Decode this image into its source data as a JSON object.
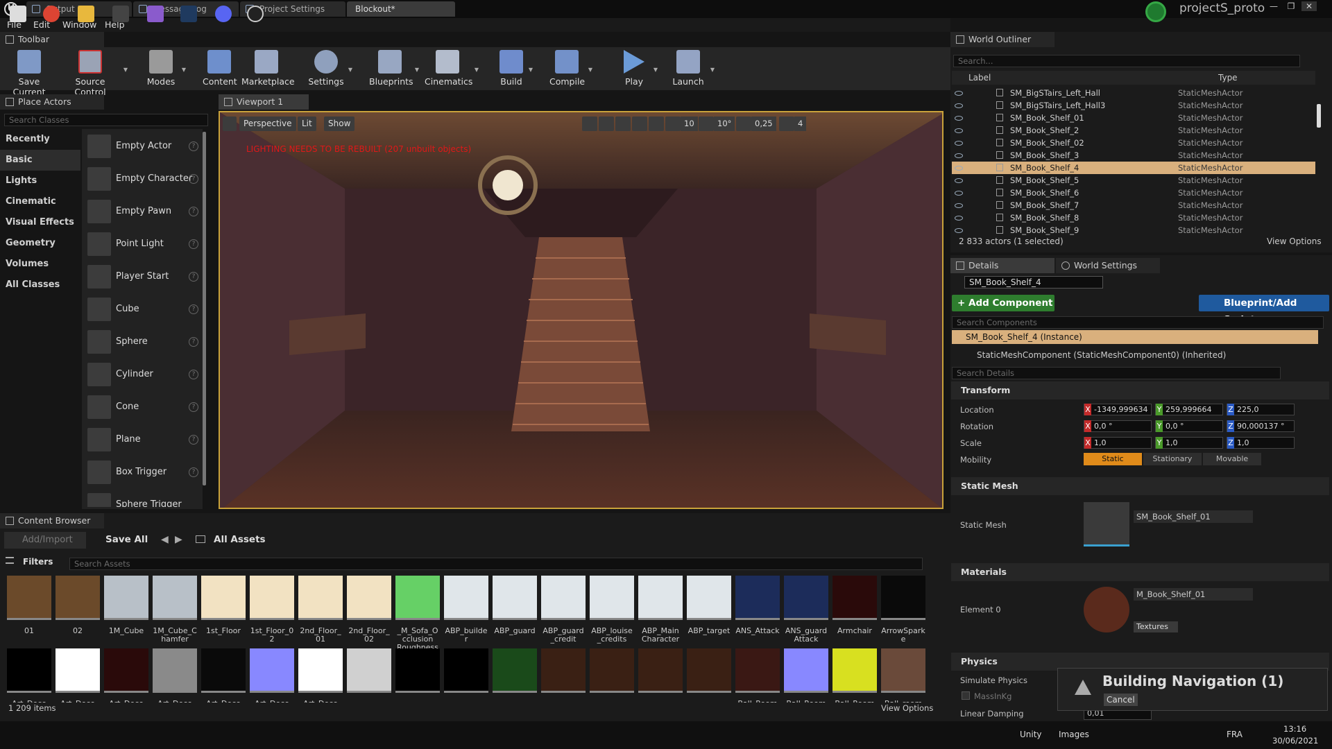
{
  "window": {
    "project_name": "projectS_proto"
  },
  "tabs": [
    "Output Log",
    "Message Log",
    "Project Settings",
    "Blockout*"
  ],
  "menu": [
    "File",
    "Edit",
    "Window",
    "Help"
  ],
  "toolbar": {
    "title": "Toolbar",
    "buttons": [
      "Save Current",
      "Source Control",
      "Modes",
      "Content",
      "Marketplace",
      "Settings",
      "Blueprints",
      "Cinematics",
      "Build",
      "Compile",
      "Play",
      "Launch"
    ]
  },
  "place_actors": {
    "title": "Place Actors",
    "search_placeholder": "Search Classes",
    "categories": [
      "Recently Placed",
      "Basic",
      "Lights",
      "Cinematic",
      "Visual Effects",
      "Geometry",
      "Volumes",
      "All Classes"
    ],
    "active_category": "Basic",
    "items": [
      "Empty Actor",
      "Empty Character",
      "Empty Pawn",
      "Point Light",
      "Player Start",
      "Cube",
      "Sphere",
      "Cylinder",
      "Cone",
      "Plane",
      "Box Trigger",
      "Sphere Trigger"
    ]
  },
  "viewport": {
    "tab": "Viewport 1",
    "buttons": {
      "perspective": "Perspective",
      "lit": "Lit",
      "show": "Show"
    },
    "grid_snap": "10",
    "rotation_snap": "10°",
    "scale_snap": "0,25",
    "camera_speed": "4",
    "warning": "LIGHTING NEEDS TO BE REBUILT (207 unbuilt objects)"
  },
  "content_browser": {
    "title": "Content Browser",
    "add_import": "Add/Import",
    "save_all": "Save All",
    "path": "All Assets",
    "filters": "Filters",
    "search_placeholder": "Search Assets",
    "item_count": "1 209 items",
    "view_options": "View Options",
    "row1": [
      "01",
      "02",
      "1M_Cube",
      "1M_Cube_Chamfer",
      "1st_Floor",
      "1st_Floor_02",
      "2nd_Floor_01",
      "2nd_Floor_02",
      "_M_Sofa_Occlusion Roughness",
      "ABP_builder",
      "ABP_guard",
      "ABP_guard_credit",
      "ABP_louise_credits",
      "ABP_Main Character",
      "ABP_target",
      "ANS_Attack",
      "ANS_guard Attack",
      "Armchair",
      "ArrowSparke"
    ],
    "row2": [
      "Art_Deco",
      "Art_Deco",
      "Art_Deco",
      "Art_Deco",
      "Art_Deco",
      "Art_Deco",
      "Art_Deco",
      "",
      "",
      "",
      "",
      "",
      "",
      "",
      "",
      "Ball_Room",
      "Ball_Room",
      "Ball_Room",
      "Ball_room"
    ]
  },
  "outliner": {
    "title": "World Outliner",
    "search_placeholder": "Search...",
    "col_label": "Label",
    "col_type": "Type",
    "rows": [
      {
        "name": "SM_BigSTairs_Left_Hall",
        "type": "StaticMeshActor"
      },
      {
        "name": "SM_BigSTairs_Left_Hall3",
        "type": "StaticMeshActor"
      },
      {
        "name": "SM_Book_Shelf_01",
        "type": "StaticMeshActor"
      },
      {
        "name": "SM_Book_Shelf_2",
        "type": "StaticMeshActor"
      },
      {
        "name": "SM_Book_Shelf_02",
        "type": "StaticMeshActor"
      },
      {
        "name": "SM_Book_Shelf_3",
        "type": "StaticMeshActor"
      },
      {
        "name": "SM_Book_Shelf_4",
        "type": "StaticMeshActor"
      },
      {
        "name": "SM_Book_Shelf_5",
        "type": "StaticMeshActor"
      },
      {
        "name": "SM_Book_Shelf_6",
        "type": "StaticMeshActor"
      },
      {
        "name": "SM_Book_Shelf_7",
        "type": "StaticMeshActor"
      },
      {
        "name": "SM_Book_Shelf_8",
        "type": "StaticMeshActor"
      },
      {
        "name": "SM_Book_Shelf_9",
        "type": "StaticMeshActor"
      }
    ],
    "selected_row": "SM_Book_Shelf_4",
    "status": "2 833 actors (1 selected)",
    "view_options": "View Options"
  },
  "details": {
    "tab_details": "Details",
    "tab_world": "World Settings",
    "actor_name": "SM_Book_Shelf_4",
    "add_component": "+ Add Component",
    "blueprint_script": "Blueprint/Add Script",
    "search_components": "Search Components",
    "instance": "SM_Book_Shelf_4 (Instance)",
    "component": "StaticMeshComponent (StaticMeshComponent0) (Inherited)",
    "search_details": "Search Details",
    "transform": {
      "title": "Transform",
      "location_label": "Location",
      "rotation_label": "Rotation",
      "scale_label": "Scale",
      "mobility_label": "Mobility",
      "location": [
        "-1349,999634",
        "259,999664",
        "225,0"
      ],
      "rotation": [
        "0,0 °",
        "0,0 °",
        "90,000137 °"
      ],
      "scale": [
        "1,0",
        "1,0",
        "1,0"
      ],
      "mobility": [
        "Static",
        "Stationary",
        "Movable"
      ]
    },
    "static_mesh": {
      "title": "Static Mesh",
      "label": "Static Mesh",
      "value": "SM_Book_Shelf_01"
    },
    "materials": {
      "title": "Materials",
      "label": "Element 0",
      "value": "M_Book_Shelf_01",
      "textures": "Textures"
    },
    "physics": {
      "title": "Physics",
      "simulate": "Simulate Physics",
      "mass": "MassInKg",
      "linear_damping": "Linear Damping",
      "linear_damping_value": "0,01"
    }
  },
  "notification": {
    "title": "Building Navigation (1)",
    "cancel": "Cancel"
  },
  "taskbar": {
    "unity": "Unity",
    "images": "Images",
    "lang": "FRA",
    "time": "13:16",
    "date": "30/06/2021"
  }
}
